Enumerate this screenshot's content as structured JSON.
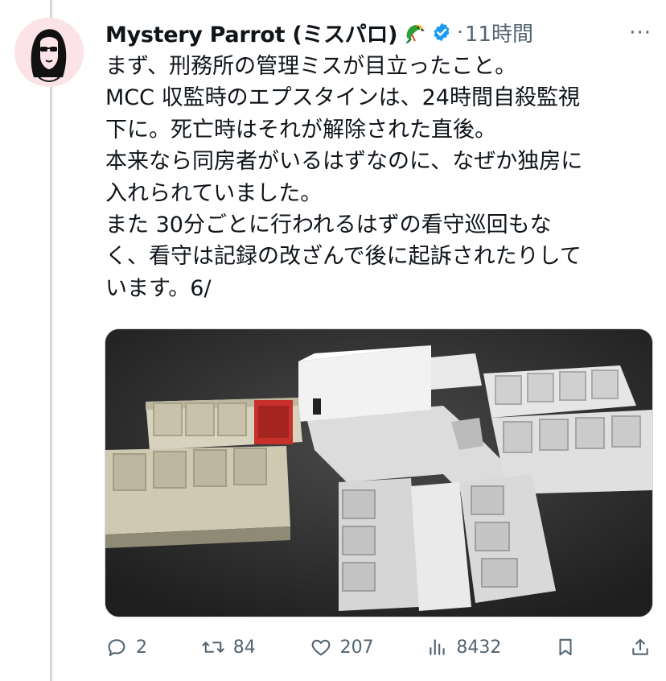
{
  "author": {
    "display_name": "Mystery Parrot (ミスパロ)",
    "avatar_icon": "woman-sunglasses-avatar",
    "name_emoji": "parrot-emoji",
    "verified_icon": "verified-badge-icon"
  },
  "meta": {
    "separator": "·",
    "timestamp": "11時間",
    "more_label": "···"
  },
  "tweet": {
    "text": "まず、刑務所の管理ミスが目立ったこと。\nMCC 収監時のエプスタインは、24時間自殺監視\n下に。死亡時はそれが解除された直後。\n本来なら同房者がいるはずなのに、なぜか独房に\n入れられていました。\nまた 30分ごとに行われるはずの看守巡回もな\nく、看守は記録の改ざんで後に起訴されたりして\nいます。6/",
    "media_description": "3D prison floor plan rendering with one highlighted red cell"
  },
  "actions": {
    "replies": "2",
    "reposts": "84",
    "likes": "207",
    "views": "8432"
  },
  "colors": {
    "text_primary": "#0f1419",
    "text_secondary": "#536471",
    "verified_blue": "#1d9bf0",
    "highlight_cell": "#c9302c"
  }
}
